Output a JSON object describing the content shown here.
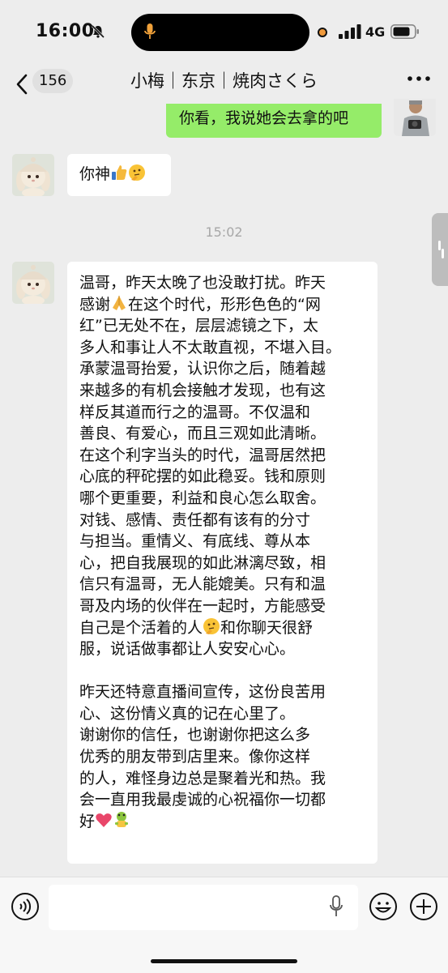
{
  "status_bar": {
    "time": "16:00",
    "network": "4G"
  },
  "nav": {
    "unread_count": "156",
    "title": "小梅｜东京｜焼肉さくら"
  },
  "messages": {
    "m1_text": "你看，我说她会去拿的吧",
    "m2_text": "你神",
    "timestamp": "15:02",
    "m3_p1": "温哥，昨天太晚了也没敢打扰。昨天\n感谢",
    "m3_p2": "在这个时代，形形色色的“网\n红”已无处不在，层层滤镜之下，太\n多人和事让人不太敢直视，不堪入目。\n承蒙温哥抬爱，认识你之后，随着越\n来越多的有机会接触才发现，也有这\n样反其道而行之的温哥。不仅温和\n善良、有爱心，而且三观如此清晰。\n在这个利字当头的时代，温哥居然把\n心底的秤砣摆的如此稳妥。钱和原则\n哪个更重要，利益和良心怎么取舍。\n对钱、感情、责任都有该有的分寸\n与担当。重情义、有底线、尊从本\n心，把自我展现的如此淋漓尽致，相\n信只有温哥，无人能媲美。只有和温\n哥及内场的伙伴在一起时，方能感受\n自己是个活着的人",
    "m3_p3": "和你聊天很舒\n服，说话做事都让人安安心心。\n\n昨天还特意直播间宣传，这份良苦用\n心、这份情义真的记在心里了。\n谢谢你的信任，也谢谢你把这么多\n优秀的朋友带到店里来。像你这样\n的人，难怪身边总是聚着光和热。我\n会一直用我最虔诚的心祝福你一切都\n好"
  },
  "colors": {
    "me_bubble": "#95ec69",
    "them_bubble": "#ffffff",
    "background": "#ededed"
  },
  "icons": [
    "bell-off-icon",
    "mic-icon",
    "signal-icon",
    "battery-icon",
    "back-chevron-icon",
    "more-icon",
    "thumbs-up-icon",
    "thinking-face-icon",
    "pray-icon",
    "heart-icon",
    "frog-icon",
    "voice-icon",
    "emoji-icon",
    "plus-icon"
  ]
}
